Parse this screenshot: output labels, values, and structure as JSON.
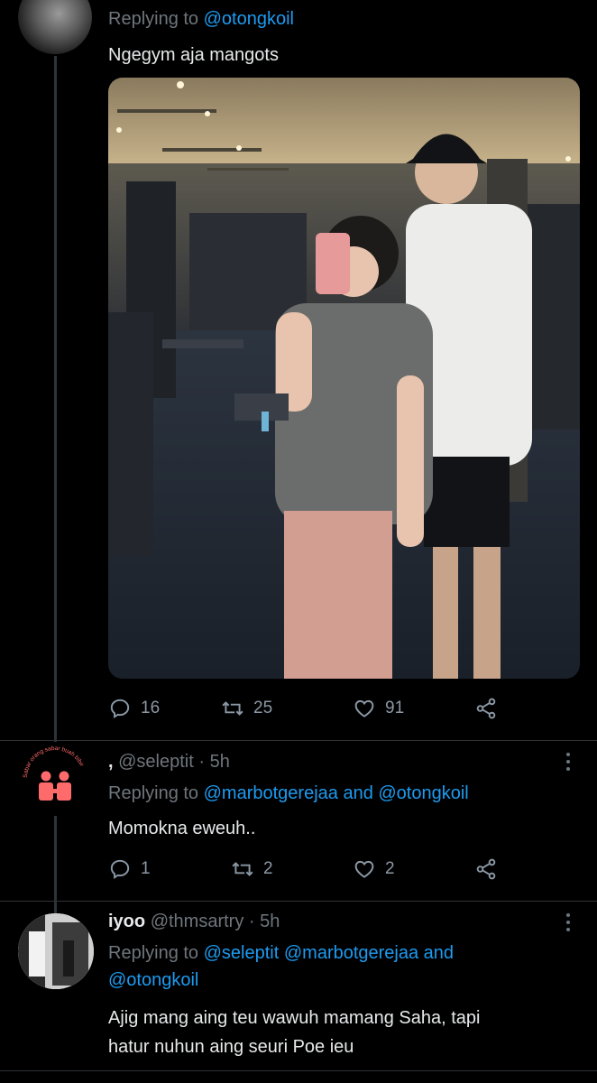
{
  "tweet1": {
    "replying_prefix": "Replying to",
    "replying_to": "@otongkoil",
    "text": "Ngegym aja mangots",
    "actions": {
      "replies": "16",
      "retweets": "25",
      "likes": "91"
    }
  },
  "tweet2": {
    "display_name": ",",
    "handle": "@seleptit",
    "time": "· 5h",
    "avatar_caption": "Sabar orang sabar buah bibir",
    "replying_prefix": "Replying to",
    "replying_to": "@marbotgerejaa and @otongkoil",
    "text": "Momokna eweuh..",
    "actions": {
      "replies": "1",
      "retweets": "2",
      "likes": "2"
    }
  },
  "tweet3": {
    "display_name": "iyoo",
    "handle": "@thmsartry",
    "time": "· 5h",
    "replying_prefix": "Replying to",
    "replying_to_1": "@seleptit @marbotgerejaa and",
    "replying_to_2": "@otongkoil",
    "text_line1": "Ajig mang aing teu wawuh mamang Saha, tapi",
    "text_line2": "hatur nuhun aing seuri Poe ieu"
  },
  "colors": {
    "background": "#000000",
    "accent": "#1d9bf0",
    "muted": "#6e767d",
    "text": "#e7e9ea"
  },
  "icons": [
    "reply-icon",
    "retweet-icon",
    "like-icon",
    "share-icon",
    "more-icon"
  ]
}
